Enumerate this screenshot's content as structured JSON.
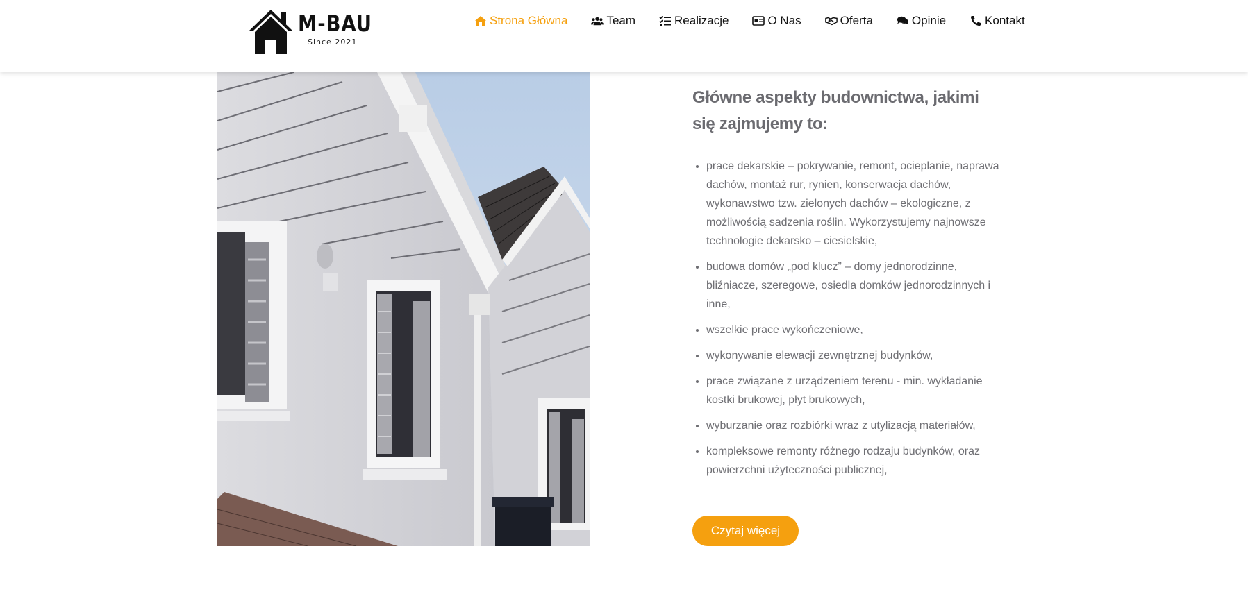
{
  "brand": {
    "name": "M-BAU",
    "tagline": "Since 2021"
  },
  "nav": {
    "items": [
      {
        "label": "Strona Główna",
        "icon": "home-icon",
        "active": true
      },
      {
        "label": "Team",
        "icon": "users-icon",
        "active": false
      },
      {
        "label": "Realizacje",
        "icon": "list-icon",
        "active": false
      },
      {
        "label": "O Nas",
        "icon": "id-card-icon",
        "active": false
      },
      {
        "label": "Oferta",
        "icon": "handshake-icon",
        "active": false
      },
      {
        "label": "Opinie",
        "icon": "comments-icon",
        "active": false
      },
      {
        "label": "Kontakt",
        "icon": "phone-icon",
        "active": false
      }
    ]
  },
  "main": {
    "heading": "Główne aspekty budownictwa, jakimi się zajmujemy to:",
    "services": [
      "prace dekarskie – pokrywanie, remont, ocieplanie, naprawa dachów, montaż rur, rynien, konserwacja dachów, wykonawstwo tzw. zielonych dachów – ekologiczne, z możliwością sadzenia roślin. Wykorzystujemy najnowsze technologie dekarsko – ciesielskie,",
      "budowa domów „pod klucz” – domy jednorodzinne, bliźniacze, szeregowe, osiedla domków jednorodzinnych i inne,",
      "wszelkie prace wykończeniowe,",
      "wykonywanie elewacji zewnętrznej budynków,",
      "prace związane z urządzeniem terenu - min. wykładanie kostki brukowej, płyt brukowych,",
      "wyburzanie oraz rozbiórki wraz z utylizacją materiałów,",
      "kompleksowe remonty różnego rodzaju budynków, oraz powierzchni użyteczności publicznej,"
    ],
    "cta_label": "Czytaj więcej"
  },
  "colors": {
    "accent": "#f5a00f",
    "text_muted": "#6e6e73",
    "heading": "#6b6b70"
  }
}
